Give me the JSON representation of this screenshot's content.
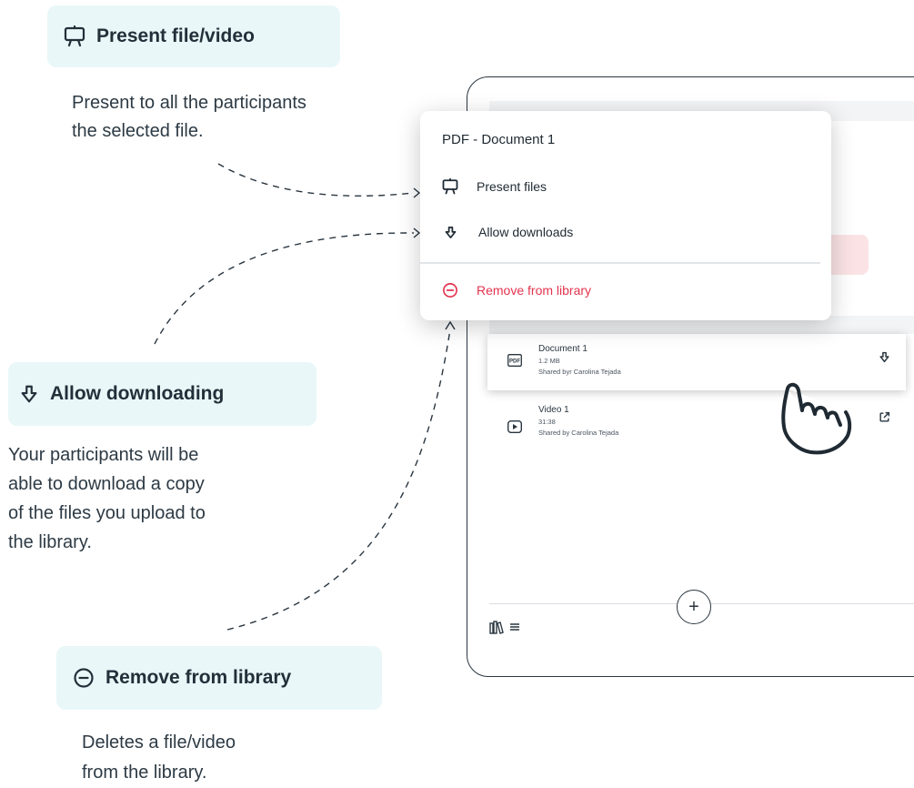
{
  "callouts": {
    "present": {
      "title": "Present file/video",
      "desc": [
        "Present to all the participants",
        "the selected file."
      ]
    },
    "download": {
      "title": "Allow downloading",
      "desc": [
        "Your participants will be",
        "able to download a copy",
        "of the files you upload to",
        "the library."
      ]
    },
    "remove": {
      "title": "Remove from library",
      "desc": [
        "Deletes a file/video",
        "from the library."
      ]
    }
  },
  "menu": {
    "title": "PDF - Document 1",
    "items": [
      {
        "label": "Present files",
        "icon": "presentation-icon"
      },
      {
        "label": "Allow downloads",
        "icon": "download-arrow-icon"
      },
      {
        "label": "Remove from library",
        "icon": "minus-circle-icon"
      }
    ]
  },
  "files": [
    {
      "name": "Document 1",
      "size": "1.2 MB",
      "shared": "Shared byr Carolina Tejada",
      "icon": "pdf-icon",
      "action_icon": "download-arrow-icon"
    },
    {
      "name": "Video 1",
      "size": "31:38",
      "shared": "Shared by Carolina Tejada",
      "icon": "play-icon",
      "action_icon": "external-link-icon"
    }
  ],
  "add_button": "+",
  "colors": {
    "callout_bg": "#e9f7f8",
    "danger": "#e3344e",
    "ink": "#1f2a33"
  }
}
